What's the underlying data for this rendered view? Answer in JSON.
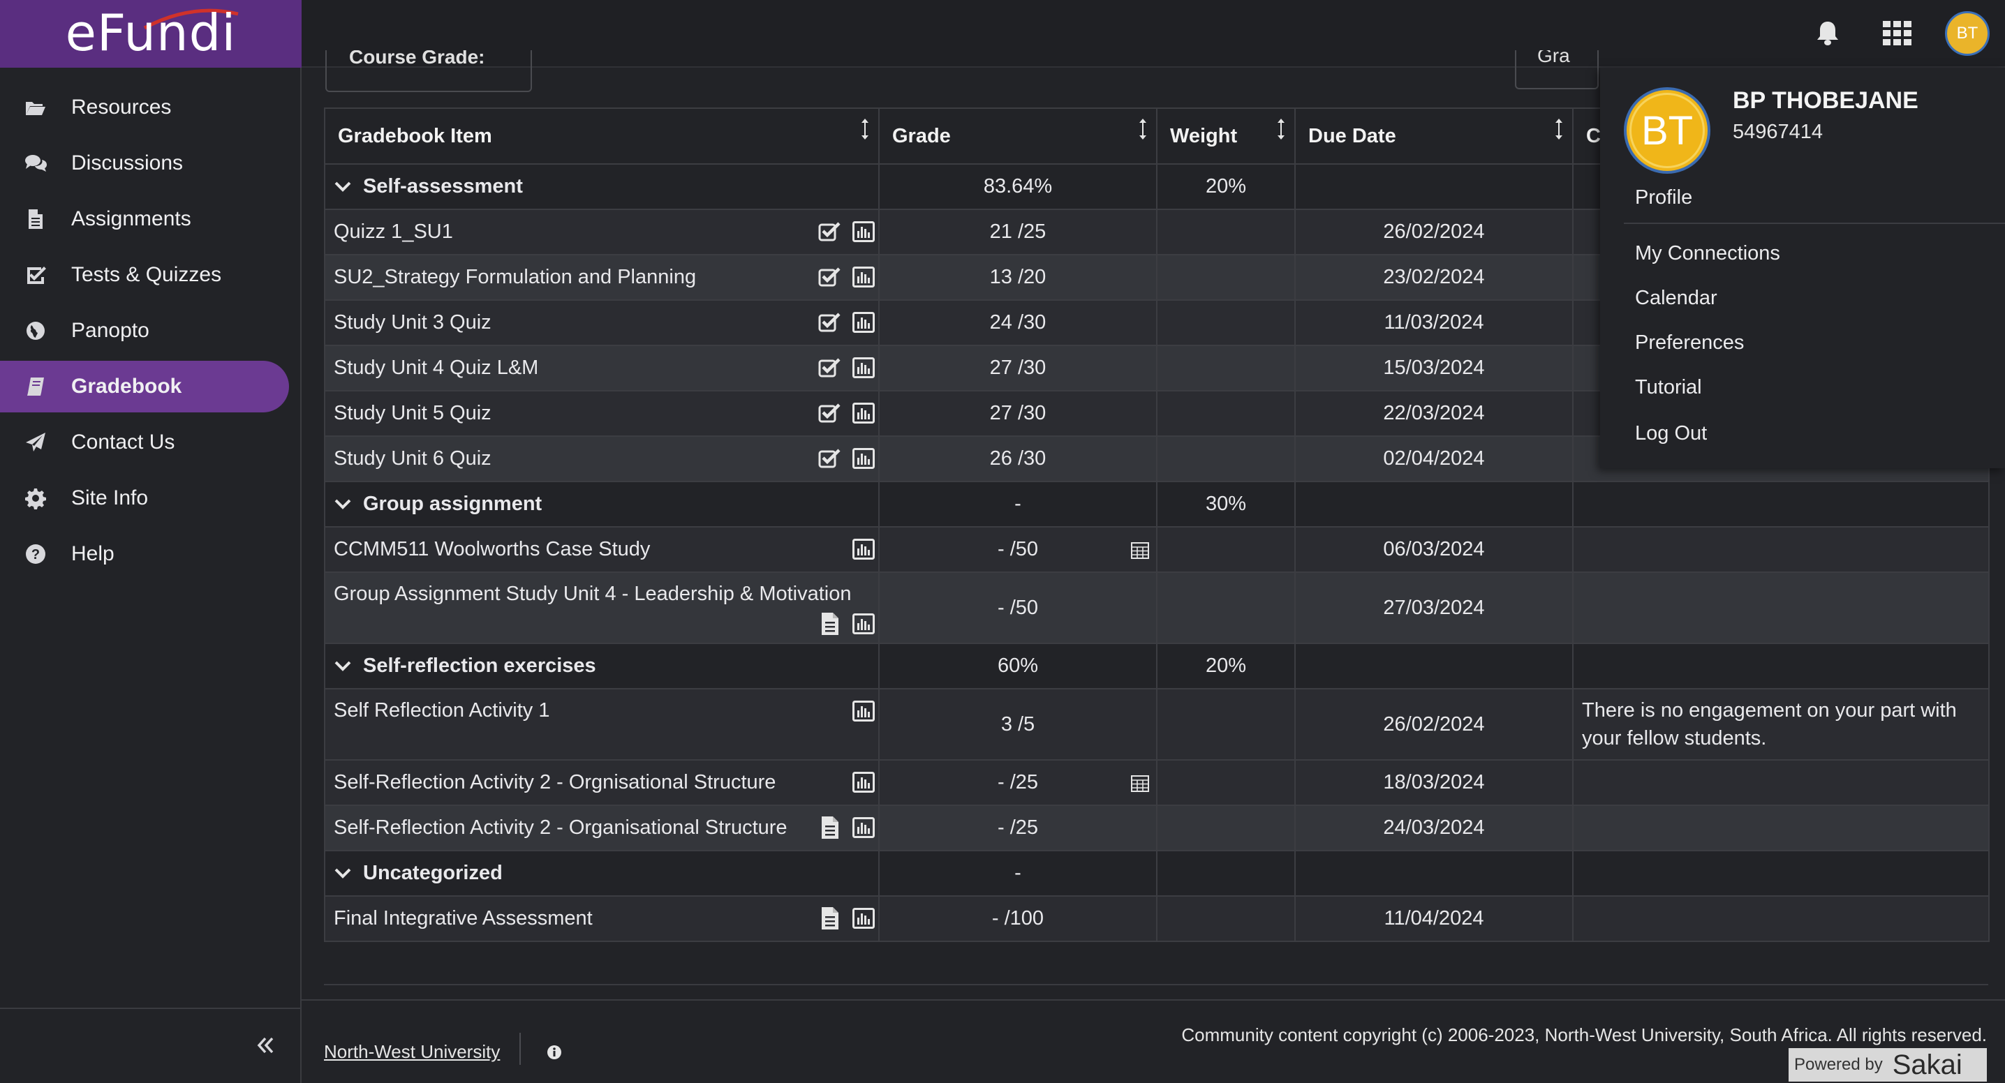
{
  "app": {
    "logo": "eFundi"
  },
  "sidebar": {
    "items": [
      {
        "label": "Resources",
        "icon": "folder-open-icon",
        "active": false
      },
      {
        "label": "Discussions",
        "icon": "comments-icon",
        "active": false
      },
      {
        "label": "Assignments",
        "icon": "file-text-icon",
        "active": false
      },
      {
        "label": "Tests & Quizzes",
        "icon": "check-square-icon",
        "active": false
      },
      {
        "label": "Panopto",
        "icon": "globe-icon",
        "active": false
      },
      {
        "label": "Gradebook",
        "icon": "book-icon",
        "active": true
      },
      {
        "label": "Contact Us",
        "icon": "paper-plane-icon",
        "active": false
      },
      {
        "label": "Site Info",
        "icon": "gear-icon",
        "active": false
      },
      {
        "label": "Help",
        "icon": "question-circle-icon",
        "active": false
      }
    ],
    "collapse_icon": "double-chevron-left-icon"
  },
  "topbar": {
    "icons": [
      "bell-icon",
      "apps-grid-icon"
    ],
    "avatar_initials": "BT"
  },
  "toolbar": {
    "course_grade_label": "Course Grade:",
    "report_label": "Gra"
  },
  "table": {
    "headers": {
      "item": "Gradebook Item",
      "grade": "Grade",
      "weight": "Weight",
      "due": "Due Date",
      "comment": "C"
    },
    "rows": [
      {
        "type": "category",
        "name": "Self-assessment",
        "grade": "83.64%",
        "weight": "20%",
        "due": "",
        "comment": ""
      },
      {
        "type": "item",
        "name": "Quizz 1_SU1",
        "grade": "21 /25",
        "due": "26/02/2024",
        "comment": ""
      },
      {
        "type": "item",
        "name": "SU2_Strategy Formulation and Planning",
        "grade": "13 /20",
        "due": "23/02/2024",
        "comment": ""
      },
      {
        "type": "item",
        "name": "Study Unit 3 Quiz",
        "grade": "24 /30",
        "due": "11/03/2024",
        "comment": ""
      },
      {
        "type": "item",
        "name": "Study Unit 4 Quiz L&M",
        "grade": "27 /30",
        "due": "15/03/2024",
        "comment": ""
      },
      {
        "type": "item",
        "name": "Study Unit 5 Quiz",
        "grade": "27 /30",
        "due": "22/03/2024",
        "comment": ""
      },
      {
        "type": "item",
        "name": "Study Unit 6 Quiz",
        "grade": "26 /30",
        "due": "02/04/2024",
        "comment": ""
      },
      {
        "type": "category",
        "name": "Group assignment",
        "grade": "-",
        "weight": "30%",
        "due": "",
        "comment": ""
      },
      {
        "type": "item",
        "name": "CCMM511 Woolworths Case Study",
        "grade": "- /50",
        "due": "06/03/2024",
        "comment": ""
      },
      {
        "type": "item",
        "name": "Group Assignment Study Unit 4 - Leadership & Motivation",
        "grade": "- /50",
        "due": "27/03/2024",
        "comment": ""
      },
      {
        "type": "category",
        "name": "Self-reflection exercises",
        "grade": "60%",
        "weight": "20%",
        "due": "",
        "comment": ""
      },
      {
        "type": "item",
        "name": "Self Reflection Activity 1",
        "grade": "3 /5",
        "due": "26/02/2024",
        "comment": "There is no engagement on your part with your fellow students."
      },
      {
        "type": "item",
        "name": "Self-Reflection Activity 2 - Orgnisational Structure",
        "grade": "- /25",
        "due": "18/03/2024",
        "comment": ""
      },
      {
        "type": "item",
        "name": "Self-Reflection Activity 2 - Organisational Structure",
        "grade": "- /25",
        "due": "24/03/2024",
        "comment": ""
      },
      {
        "type": "category",
        "name": "Uncategorized",
        "grade": "-",
        "weight": "",
        "due": "",
        "comment": ""
      },
      {
        "type": "item",
        "name": "Final Integrative Assessment",
        "grade": "- /100",
        "due": "11/04/2024",
        "comment": ""
      }
    ]
  },
  "footer": {
    "institution_link": "North-West University",
    "copyright": "Community content copyright (c) 2006-2023, North-West University, South Africa. All rights reserved.",
    "powered_by": "Powered by",
    "sakai": "Sakai"
  },
  "profile_menu": {
    "initials": "BT",
    "name": "BP THOBEJANE",
    "user_id": "54967414",
    "items": [
      "Profile",
      "My Connections",
      "Calendar",
      "Preferences",
      "Tutorial",
      "Log Out"
    ]
  }
}
